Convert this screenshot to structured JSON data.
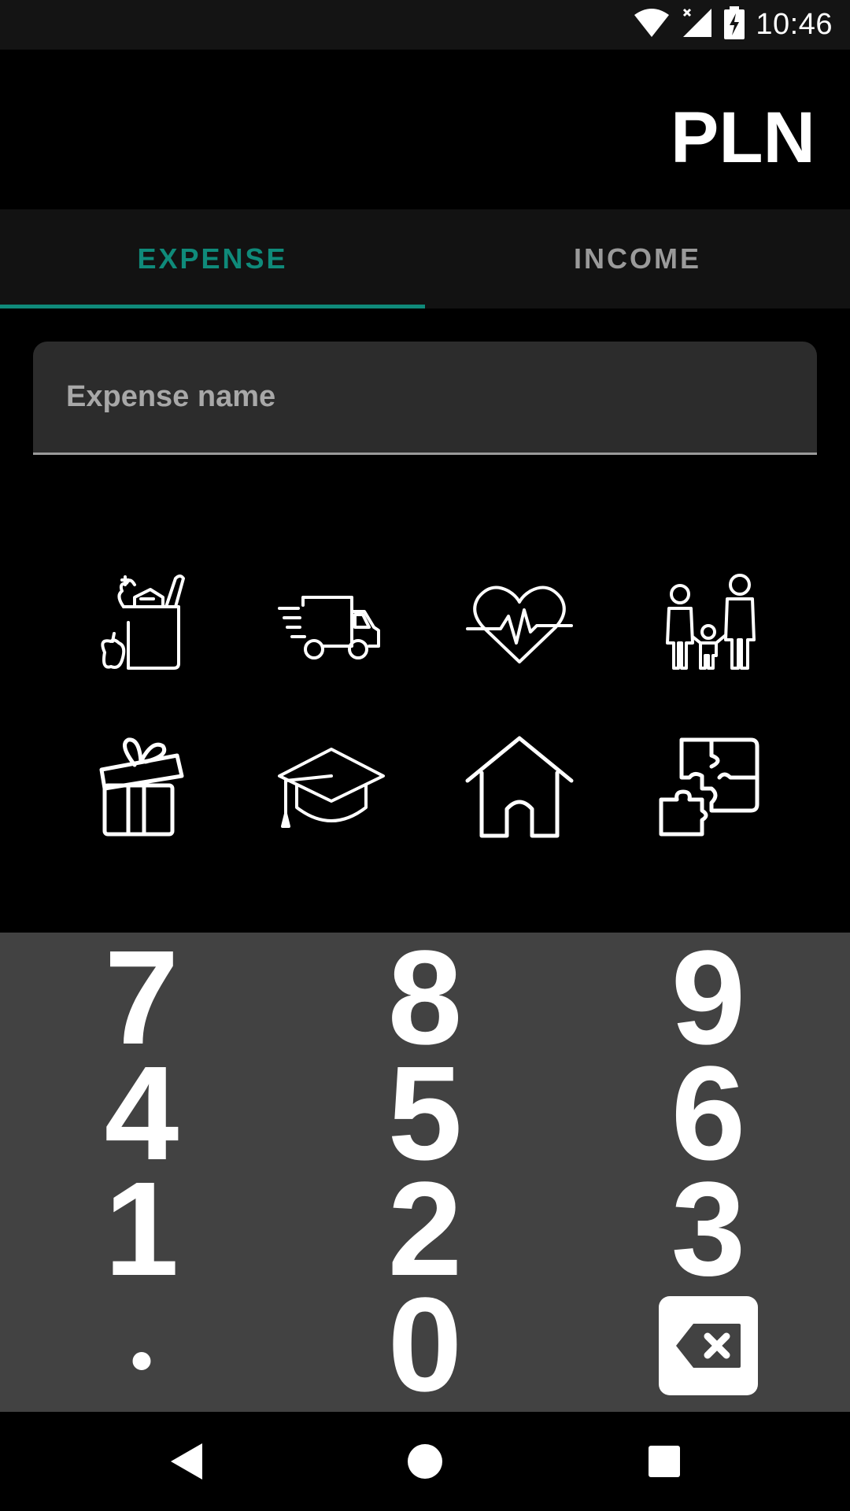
{
  "status_bar": {
    "time": "10:46",
    "icons": [
      "wifi-icon",
      "signal-icon",
      "battery-charging-icon"
    ]
  },
  "header": {
    "currency": "PLN"
  },
  "tabs": [
    {
      "label": "EXPENSE",
      "active": true
    },
    {
      "label": "INCOME",
      "active": false
    }
  ],
  "expense_name": {
    "placeholder": "Expense name",
    "value": ""
  },
  "categories": [
    {
      "icon": "groceries-icon"
    },
    {
      "icon": "delivery-truck-icon"
    },
    {
      "icon": "heart-health-icon"
    },
    {
      "icon": "family-icon"
    },
    {
      "icon": "gift-icon"
    },
    {
      "icon": "graduation-cap-icon"
    },
    {
      "icon": "house-icon"
    },
    {
      "icon": "puzzle-icon"
    }
  ],
  "keypad": {
    "keys": [
      "7",
      "8",
      "9",
      "4",
      "5",
      "6",
      "1",
      "2",
      "3",
      "•",
      "0"
    ],
    "backspace_icon": "backspace-icon"
  },
  "nav_bar": {
    "icons": [
      "back-icon",
      "home-icon",
      "recents-icon"
    ]
  },
  "colors": {
    "accent": "#0f8a7a",
    "keypad_bg": "#424242",
    "tabs_bg": "#121212",
    "field_bg": "#2c2c2c"
  }
}
